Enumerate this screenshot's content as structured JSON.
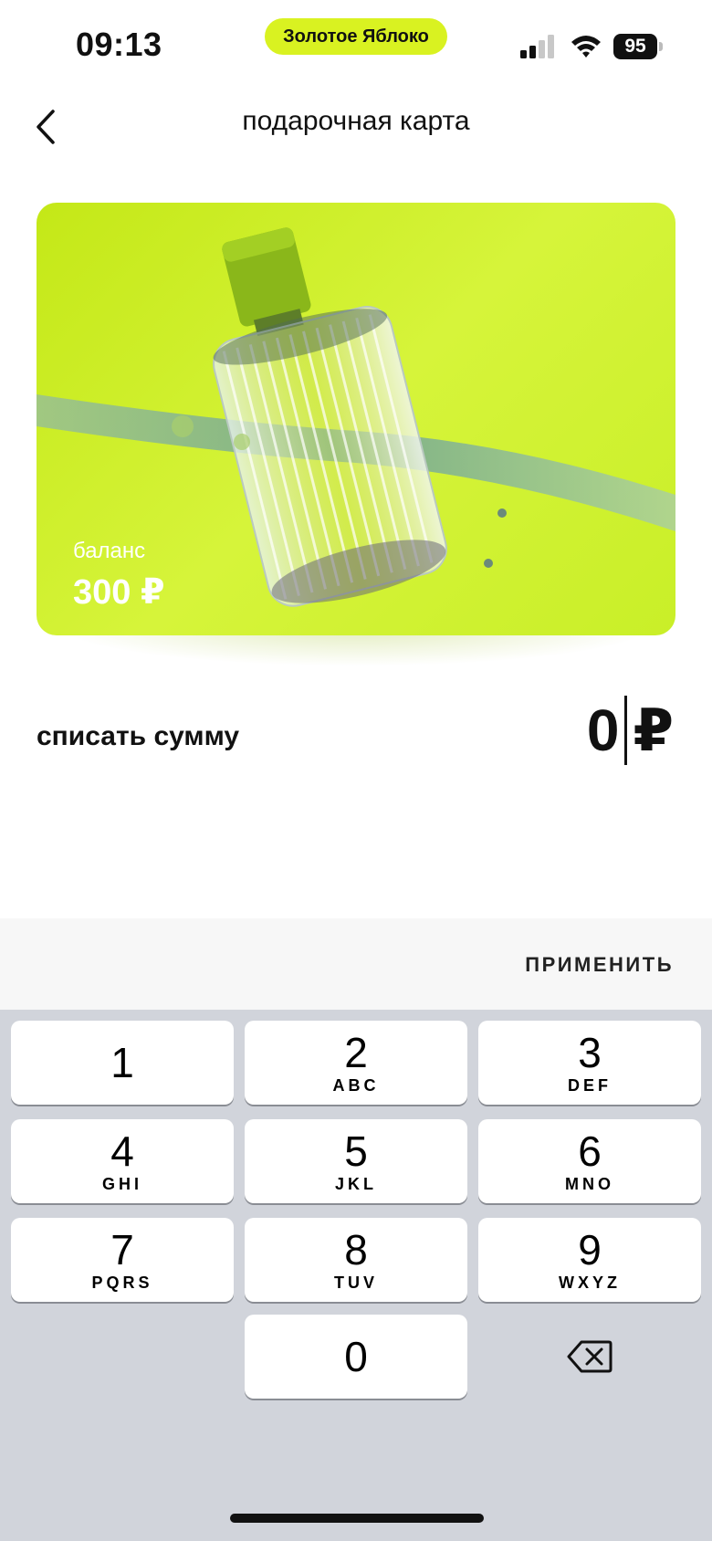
{
  "status_bar": {
    "time": "09:13",
    "app_pill": "Золотое Яблоко",
    "battery": "95"
  },
  "header": {
    "title": "подарочная карта",
    "back_icon": "chevron-left-icon"
  },
  "card": {
    "balance_label": "баланс",
    "balance_value": "300 ₽",
    "accent_color": "#d2f12b"
  },
  "writeoff": {
    "label": "списать сумму",
    "amount": "0",
    "currency": "₽"
  },
  "apply": {
    "label": "ПРИМЕНИТЬ"
  },
  "keypad": {
    "keys": [
      {
        "digit": "1",
        "letters": ""
      },
      {
        "digit": "2",
        "letters": "ABC"
      },
      {
        "digit": "3",
        "letters": "DEF"
      },
      {
        "digit": "4",
        "letters": "GHI"
      },
      {
        "digit": "5",
        "letters": "JKL"
      },
      {
        "digit": "6",
        "letters": "MNO"
      },
      {
        "digit": "7",
        "letters": "PQRS"
      },
      {
        "digit": "8",
        "letters": "TUV"
      },
      {
        "digit": "9",
        "letters": "WXYZ"
      },
      {
        "digit": "0",
        "letters": ""
      }
    ],
    "backspace_icon": "backspace-icon"
  }
}
